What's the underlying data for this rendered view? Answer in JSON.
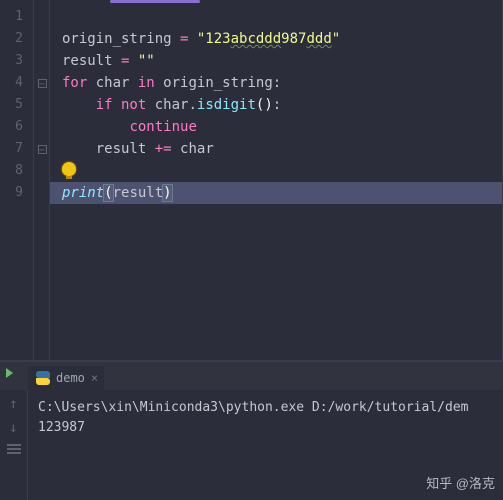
{
  "editor": {
    "lines": [
      {
        "n": "1",
        "tokens": []
      },
      {
        "n": "2",
        "tokens": [
          {
            "t": "origin_string ",
            "c": "var"
          },
          {
            "t": "= ",
            "c": "op"
          },
          {
            "t": "\"123",
            "c": "str"
          },
          {
            "t": "abcddd",
            "c": "str underline-wavy"
          },
          {
            "t": "987",
            "c": "str"
          },
          {
            "t": "ddd",
            "c": "str underline-wavy"
          },
          {
            "t": "\"",
            "c": "str"
          }
        ]
      },
      {
        "n": "3",
        "tokens": [
          {
            "t": "result ",
            "c": "var"
          },
          {
            "t": "= ",
            "c": "op"
          },
          {
            "t": "\"\"",
            "c": "str"
          }
        ]
      },
      {
        "n": "4",
        "fold": true,
        "tokens": [
          {
            "t": "for ",
            "c": "kw"
          },
          {
            "t": "char ",
            "c": "var"
          },
          {
            "t": "in ",
            "c": "kw"
          },
          {
            "t": "origin_string",
            "c": "var"
          },
          {
            "t": ":",
            "c": "plain"
          }
        ]
      },
      {
        "n": "5",
        "indent": 1,
        "tokens": [
          {
            "t": "if not ",
            "c": "kw"
          },
          {
            "t": "char",
            "c": "var"
          },
          {
            "t": ".",
            "c": "plain"
          },
          {
            "t": "isdigit",
            "c": "fn"
          },
          {
            "t": "()",
            "c": "paren"
          },
          {
            "t": ":",
            "c": "plain"
          }
        ]
      },
      {
        "n": "6",
        "indent": 2,
        "tokens": [
          {
            "t": "continue",
            "c": "kw"
          }
        ]
      },
      {
        "n": "7",
        "foldEnd": true,
        "indent": 1,
        "tokens": [
          {
            "t": "result ",
            "c": "var"
          },
          {
            "t": "+= ",
            "c": "op"
          },
          {
            "t": "char",
            "c": "var"
          }
        ]
      },
      {
        "n": "8",
        "bulb": true,
        "tokens": []
      },
      {
        "n": "9",
        "current": true,
        "tokens": [
          {
            "t": "print",
            "c": "builtin"
          },
          {
            "t": "(",
            "c": "paren paren-match"
          },
          {
            "t": "result",
            "c": "var"
          },
          {
            "t": ")",
            "c": "paren paren-match"
          }
        ]
      }
    ]
  },
  "terminal": {
    "tab_label": "demo",
    "command_line": "C:\\Users\\xin\\Miniconda3\\python.exe D:/work/tutorial/dem",
    "output": "123987"
  },
  "watermark": "知乎 @洛克"
}
